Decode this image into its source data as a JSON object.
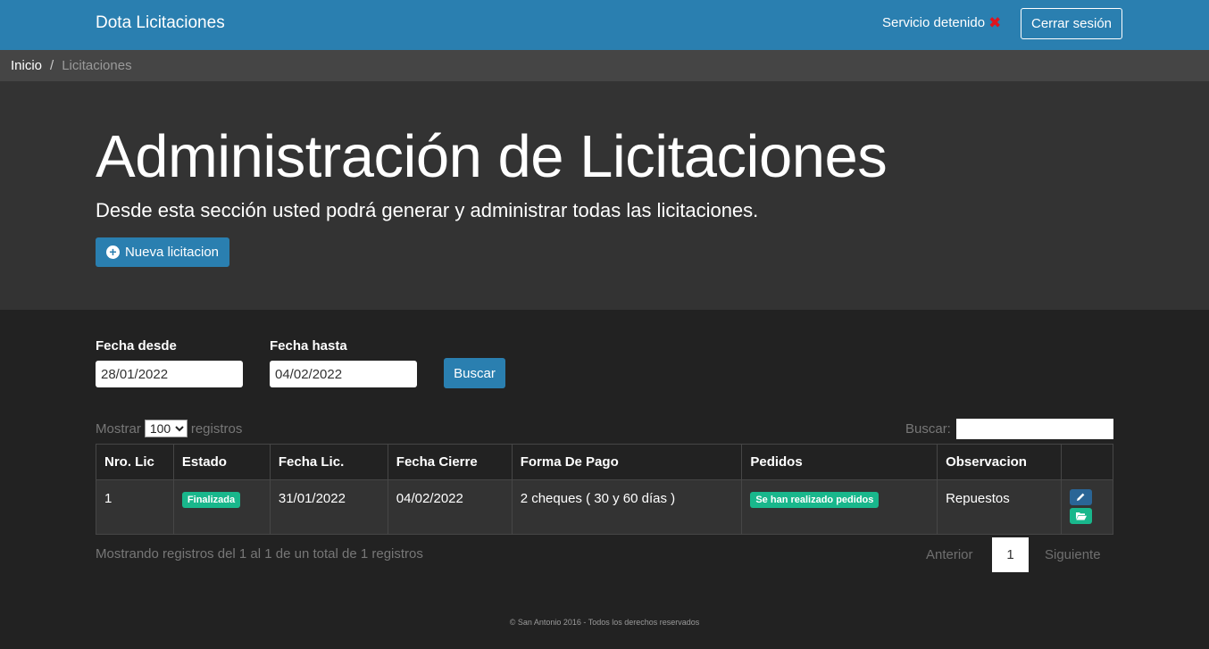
{
  "navbar": {
    "brand": "Dota Licitaciones",
    "service_status": "Servicio detenido",
    "logout_label": "Cerrar sesión"
  },
  "breadcrumb": {
    "home": "Inicio",
    "separator": "/",
    "current": "Licitaciones"
  },
  "header": {
    "title": "Administración de Licitaciones",
    "subtitle": "Desde esta sección usted podrá generar y administrar todas las licitaciones.",
    "new_button_label": "Nueva licitacion"
  },
  "filters": {
    "from_label": "Fecha desde",
    "from_value": "28/01/2022",
    "to_label": "Fecha hasta",
    "to_value": "04/02/2022",
    "search_button_label": "Buscar"
  },
  "datatable": {
    "length_prefix": "Mostrar",
    "length_selected": "100",
    "length_suffix": "registros",
    "search_label": "Buscar:",
    "search_value": "",
    "columns": [
      "Nro. Lic",
      "Estado",
      "Fecha Lic.",
      "Fecha Cierre",
      "Forma De Pago",
      "Pedidos",
      "Observacion",
      ""
    ],
    "rows": [
      {
        "nro": "1",
        "estado": "Finalizada",
        "fecha_lic": "31/01/2022",
        "fecha_cierre": "04/02/2022",
        "forma_pago": "2 cheques ( 30 y 60 días )",
        "pedidos": "Se han realizado pedidos",
        "observacion": "Repuestos"
      }
    ],
    "info": "Mostrando registros del 1 al 1 de un total de 1 registros",
    "pagination": {
      "previous": "Anterior",
      "current_page": "1",
      "next": "Siguiente"
    }
  },
  "footer": {
    "text": "© San Antonio 2016 - Todos los derechos reservados"
  },
  "colors": {
    "primary": "#2a7fb0",
    "success_badge": "#19b78c",
    "danger_icon": "#e0141e",
    "background": "#222222",
    "jumbotron": "#333333",
    "breadcrumb_bg": "#454545"
  },
  "icons": {
    "status": "x-icon",
    "new": "plus-circle-icon",
    "edit": "pencil-icon",
    "open": "folder-open-icon"
  }
}
